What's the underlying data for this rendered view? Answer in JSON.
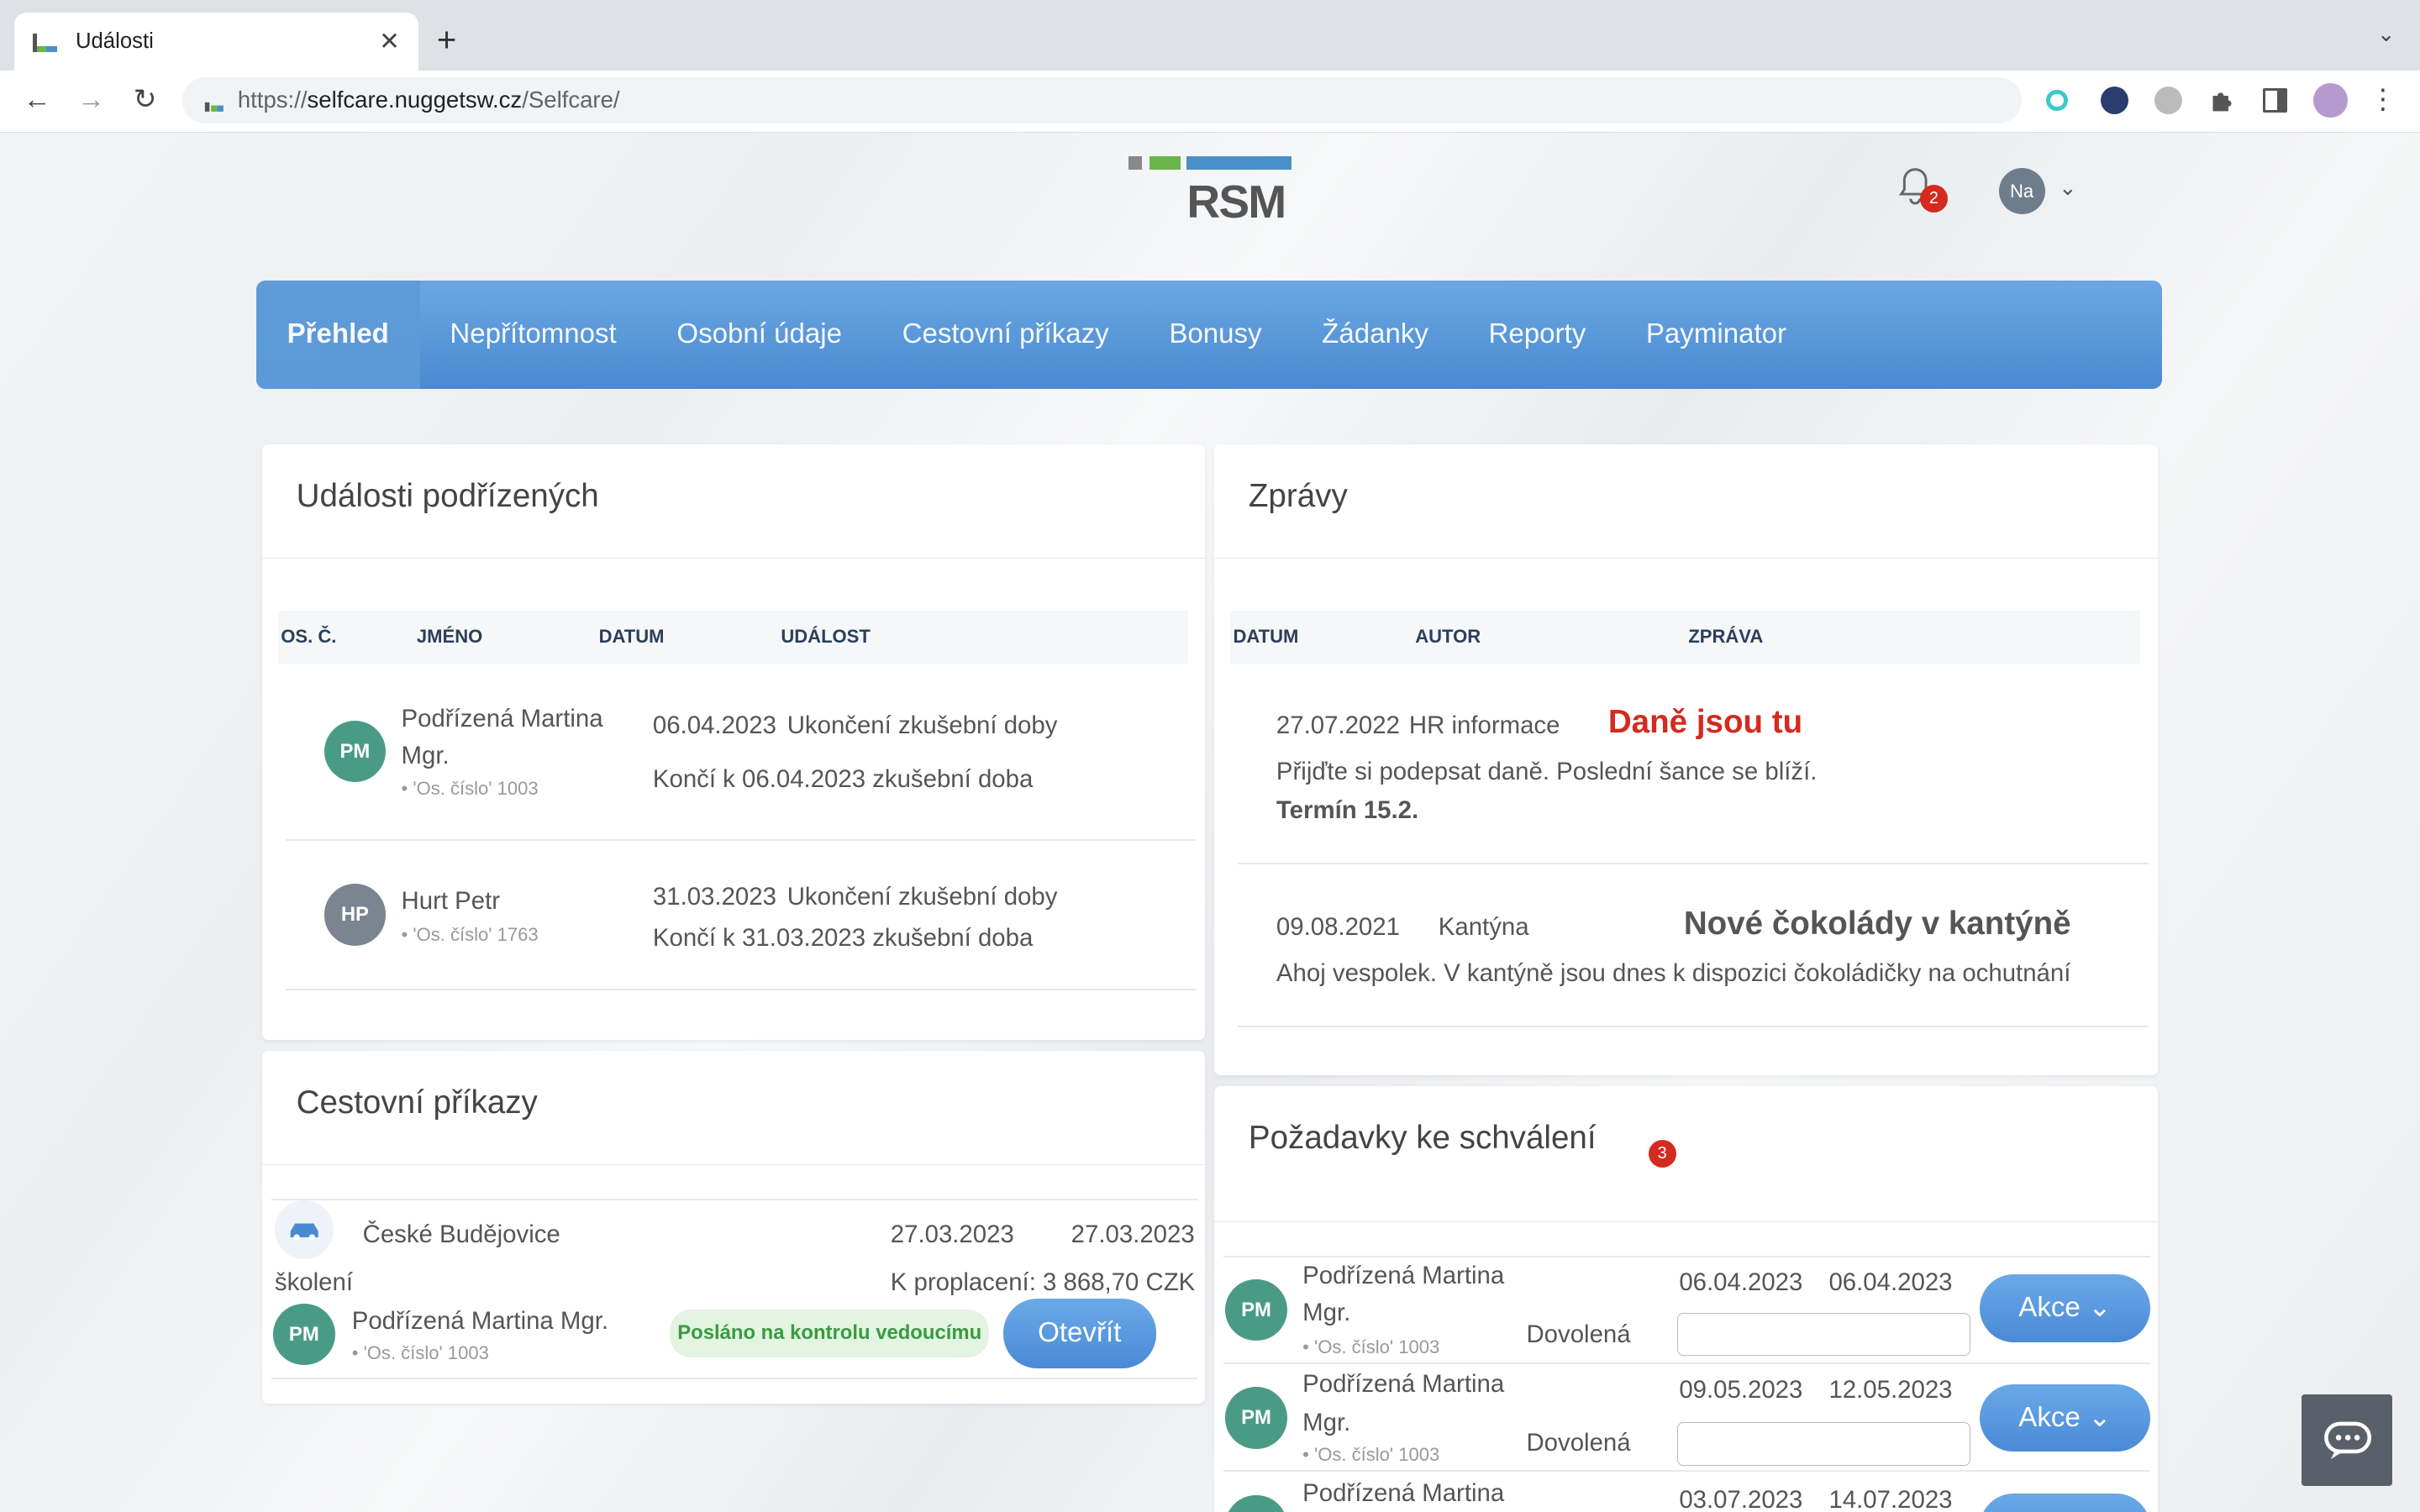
{
  "browser": {
    "tab_title": "Události",
    "tab_close": "✕",
    "new_tab": "+",
    "tab_menu": "⌄",
    "url_prefix": "https://",
    "url_host": "selfcare.nuggetsw.cz",
    "url_path": "/Selfcare/",
    "back": "←",
    "forward": "→",
    "reload": "↻",
    "menu": "⋮"
  },
  "header": {
    "logo_text": "RSM",
    "notifications_count": "2",
    "user_initials": "Na",
    "user_chevron": "⌄"
  },
  "nav": {
    "items": [
      {
        "label": "Přehled",
        "active": true
      },
      {
        "label": "Nepřítomnost"
      },
      {
        "label": "Osobní údaje"
      },
      {
        "label": "Cestovní příkazy"
      },
      {
        "label": "Bonusy"
      },
      {
        "label": "Žádanky"
      },
      {
        "label": "Reporty"
      },
      {
        "label": "Payminator"
      }
    ]
  },
  "events": {
    "title": "Události podřízených",
    "columns": [
      "OS. Č.",
      "JMÉNO",
      "DATUM",
      "UDÁLOST"
    ],
    "rows": [
      {
        "initials": "PM",
        "name1": "Podřízená Martina",
        "name2": "Mgr.",
        "osc": "• 'Os. číslo' 1003",
        "date": "06.04.2023",
        "event": "Ukončení zkušební doby",
        "detail": "Končí k 06.04.2023 zkušební doba"
      },
      {
        "initials": "HP",
        "name1": "Hurt Petr",
        "osc": "• 'Os. číslo' 1763",
        "date": "31.03.2023",
        "event": "Ukončení zkušební doby",
        "detail": "Končí k 31.03.2023 zkušební doba"
      }
    ]
  },
  "messages": {
    "title": "Zprávy",
    "columns": [
      "DATUM",
      "AUTOR",
      "ZPRÁVA"
    ],
    "rows": [
      {
        "date": "27.07.2022",
        "author": "HR informace",
        "headline": "Daně jsou tu",
        "text": "Přijďte si podepsat daně. Poslední šance se blíží.",
        "bold": "Termín 15.2."
      },
      {
        "date": "09.08.2021",
        "author": "Kantýna",
        "headline": "Nové čokolády v kantýně",
        "text": "Ahoj vespolek. V kantýně jsou dnes k dispozici čokoládičky na ochutnání"
      }
    ]
  },
  "travel": {
    "title": "Cestovní příkazy",
    "destination": "České Budějovice",
    "date_from": "27.03.2023",
    "date_to": "27.03.2023",
    "purpose": "školení",
    "reimburse": "K proplacení: 3 868,70 CZK",
    "initials": "PM",
    "name": "Podřízená Martina Mgr.",
    "osc": "• 'Os. číslo' 1003",
    "status": "Posláno na kontrolu vedoucímu",
    "open_label": "Otevřít"
  },
  "approvals": {
    "title": "Požadavky ke schválení",
    "count": "3",
    "action_label": "Akce",
    "rows": [
      {
        "initials": "PM",
        "name1": "Podřízená Martina",
        "name2": "Mgr.",
        "osc": "• 'Os. číslo' 1003",
        "type": "Dovolená",
        "from": "06.04.2023",
        "to": "06.04.2023"
      },
      {
        "initials": "PM",
        "name1": "Podřízená Martina",
        "name2": "Mgr.",
        "osc": "• 'Os. číslo' 1003",
        "type": "Dovolená",
        "from": "09.05.2023",
        "to": "12.05.2023"
      },
      {
        "initials": "PM",
        "name1": "Podřízená Martina",
        "from": "03.07.2023",
        "to": "14.07.2023"
      }
    ]
  },
  "colors": {
    "accent": "#4a8ad0",
    "danger": "#d42a1f",
    "avatar_green": "#4a9b86"
  }
}
